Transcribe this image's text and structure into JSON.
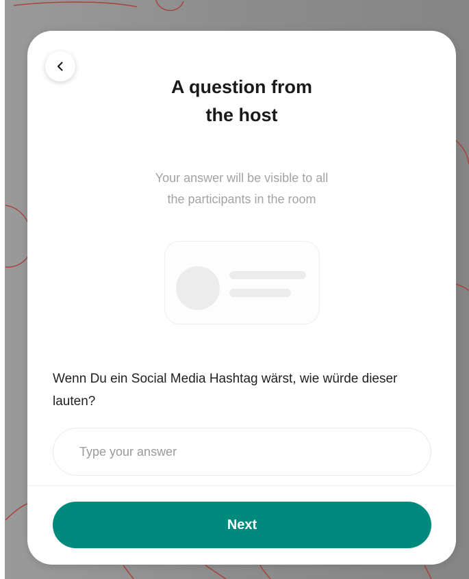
{
  "modal": {
    "title": "A question from\nthe host",
    "subtitle": "Your answer will be visible to all\nthe participants in the room",
    "question": "Wenn Du ein Social Media Hashtag wärst, wie würde dieser lauten?",
    "answer_placeholder": "Type your answer",
    "answer_value": "",
    "next_label": "Next",
    "back_icon": "chevron-left-icon"
  },
  "colors": {
    "accent": "#00897d",
    "backdrop": "#8f8f8f",
    "doodle": "#b0453d"
  }
}
